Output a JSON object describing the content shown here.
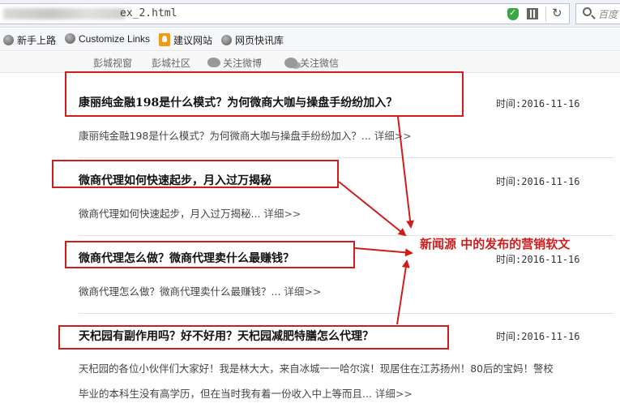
{
  "browser": {
    "url_visible": "ex_2.html",
    "search_placeholder": "百度"
  },
  "bookmarks": [
    {
      "label": "新手上路",
      "icon": "globe-icon"
    },
    {
      "label": "Customize Links",
      "icon": "globe-icon"
    },
    {
      "label": "建议网站",
      "icon": "bulb-icon"
    },
    {
      "label": "网页快讯库",
      "icon": "globe-icon"
    }
  ],
  "site_nav": [
    {
      "label": "彭城视窗"
    },
    {
      "label": "彭城社区"
    },
    {
      "label": "关注微博",
      "icon": "weibo-icon"
    },
    {
      "label": "关注微信",
      "icon": "wechat-icon"
    }
  ],
  "articles": [
    {
      "title": "康丽纯金融198是什么模式？为何微商大咖与操盘手纷纷加入？",
      "time": "时间:2016-11-16",
      "excerpt": "康丽纯金融198是什么模式？为何微商大咖与操盘手纷纷加入？...",
      "more": "详细>>"
    },
    {
      "title": "微商代理如何快速起步，月入过万揭秘",
      "time": "时间:2016-11-16",
      "excerpt": "微商代理如何快速起步，月入过万揭秘...",
      "more": "详细>>"
    },
    {
      "title": "微商代理怎么做？微商代理卖什么最赚钱？",
      "time": "时间:2016-11-16",
      "excerpt": "微商代理怎么做？微商代理卖什么最赚钱？...",
      "more": "详细>>"
    },
    {
      "title": "天杞园有副作用吗？好不好用？天杞园减肥特膳怎么代理？",
      "time": "时间:2016-11-16",
      "excerpt": "天杞园的各位小伙伴们大家好！我是林大大，来自冰城一一哈尔滨！现居住在江苏扬州！80后的宝妈！警校",
      "excerpt_line2": "毕业的本科生没有高学历，但在当时我有着一份收入中上等而且...",
      "more": "详细>>"
    }
  ],
  "annotation": {
    "label": "新闻源 中的发布的营销软文",
    "color": "#d11c1c"
  }
}
